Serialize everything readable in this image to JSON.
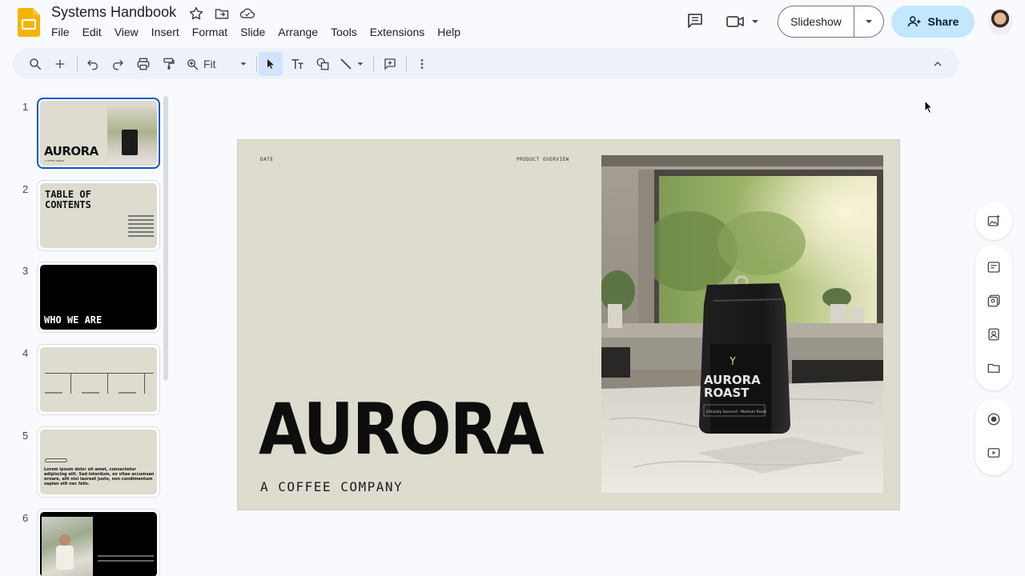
{
  "app": {
    "doc_title": "Systems Handbook",
    "accent": "#0b57d0",
    "logo_color": "#f4b400"
  },
  "menu": [
    "File",
    "Edit",
    "View",
    "Insert",
    "Format",
    "Slide",
    "Arrange",
    "Tools",
    "Extensions",
    "Help"
  ],
  "header": {
    "slideshow_label": "Slideshow",
    "share_label": "Share"
  },
  "toolbar": {
    "zoom_label": "Fit"
  },
  "filmstrip": {
    "slides": [
      {
        "num": "1",
        "title": "AURORA",
        "caption": "A COFFEE COMPANY"
      },
      {
        "num": "2",
        "title": "TABLE OF CONTENTS"
      },
      {
        "num": "3",
        "title": "WHO WE ARE"
      },
      {
        "num": "4"
      },
      {
        "num": "5",
        "body": "Lorem ipsum dolor sit amet, consectetur adipiscing elit. Sed interdum, ex vitae accumsan ornare, elit nisi laoreet justo, non condimentum sapien elit nec felis."
      },
      {
        "num": "6"
      }
    ]
  },
  "slide": {
    "date_label": "DATE",
    "overview_label": "PRODUCT OVERVIEW",
    "title": "AURORA",
    "subtitle": "A COFFEE COMPANY",
    "bag_label": "AURORA ROAST",
    "bag_small": "Ethically Sourced · Medium Roast",
    "background": "#dddcce"
  }
}
